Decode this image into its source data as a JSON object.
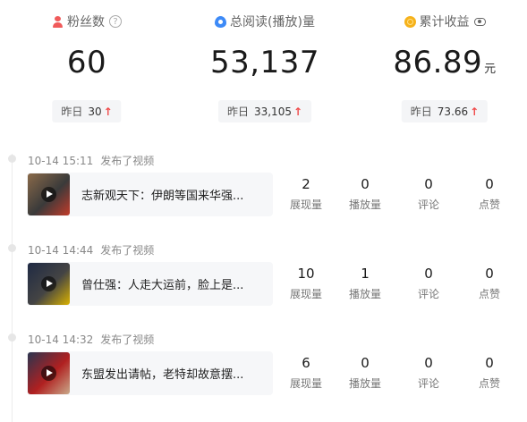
{
  "stats": [
    {
      "label": "粉丝数",
      "icon": "person-icon",
      "value": "60",
      "unit": "",
      "yesterday_label": "昨日",
      "yesterday_value": "30",
      "trend": "up",
      "extra_icon": "help-icon"
    },
    {
      "label": "总阅读(播放)量",
      "icon": "drop-icon",
      "value": "53,137",
      "unit": "",
      "yesterday_label": "昨日",
      "yesterday_value": "33,105",
      "trend": "up",
      "extra_icon": ""
    },
    {
      "label": "累计收益",
      "icon": "coin-icon",
      "value": "86.89",
      "unit": "元",
      "yesterday_label": "昨日",
      "yesterday_value": "73.66",
      "trend": "up",
      "extra_icon": "eye-icon"
    }
  ],
  "trend_arrow": "↑",
  "metric_labels": [
    "展现量",
    "播放量",
    "评论",
    "点赞"
  ],
  "entries": [
    {
      "time": "10-14 15:11",
      "action": "发布了视频",
      "title": "志新观天下：伊朗等国来华强...",
      "metrics": [
        "2",
        "0",
        "0",
        "0"
      ],
      "thumb_colors": [
        "#8a6a4a",
        "#c23b2a",
        "#3a3a3a"
      ]
    },
    {
      "time": "10-14 14:44",
      "action": "发布了视频",
      "title": "曾仕强：人走大运前，脸上是...",
      "metrics": [
        "10",
        "1",
        "0",
        "0"
      ],
      "thumb_colors": [
        "#1f2a44",
        "#d9b100",
        "#444"
      ]
    },
    {
      "time": "10-14 14:32",
      "action": "发布了视频",
      "title": "东盟发出请帖，老特却故意摆...",
      "metrics": [
        "6",
        "0",
        "0",
        "0"
      ],
      "thumb_colors": [
        "#2a3550",
        "#c9a98a",
        "#b02020"
      ]
    }
  ]
}
